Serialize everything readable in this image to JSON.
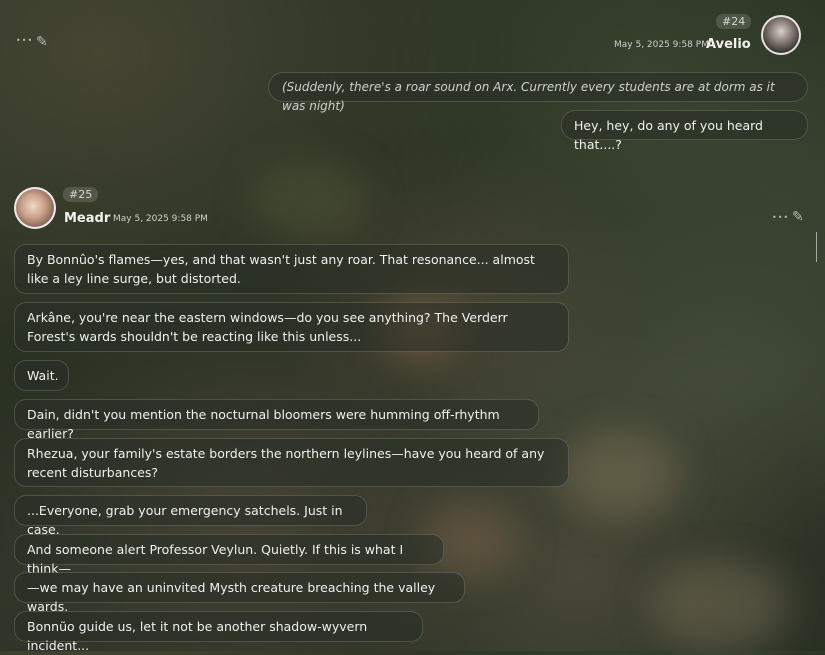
{
  "messages": {
    "m24": {
      "badge": "#24",
      "timestamp": "May 5, 2025 9:58 PM",
      "author": "Avelio",
      "actions": {
        "more": "•••",
        "edit": "✎"
      },
      "bubbles": [
        "(Suddenly, there's a roar sound on Arx. Currently every students are at dorm as it was night)",
        "Hey, hey, do any of you heard that....?"
      ]
    },
    "m25": {
      "badge": "#25",
      "timestamp": "May 5, 2025 9:58 PM",
      "author": "Meadr",
      "actions": {
        "more": "•••",
        "edit": "✎"
      },
      "bubbles": [
        "By Bonnûo's flames—yes, and that wasn't just any roar. That resonance... almost like a ley line surge, but distorted.",
        "Arkâne, you're near the eastern windows—do you see anything? The Verderr Forest's wards shouldn't be reacting like this unless...",
        "Wait.",
        "Dain, didn't you mention the nocturnal bloomers were humming off-rhythm earlier?",
        "Rhezua, your family's estate borders the northern leylines—have you heard of any recent disturbances?",
        "...Everyone, grab your emergency satchels. Just in case.",
        "And someone alert Professor Veylun. Quietly. If this is what I think—",
        "—we may have an uninvited Mysth creature breaching the valley wards.",
        "Bonnũo guide us, let it not be another shadow-wyvern incident..."
      ]
    }
  }
}
